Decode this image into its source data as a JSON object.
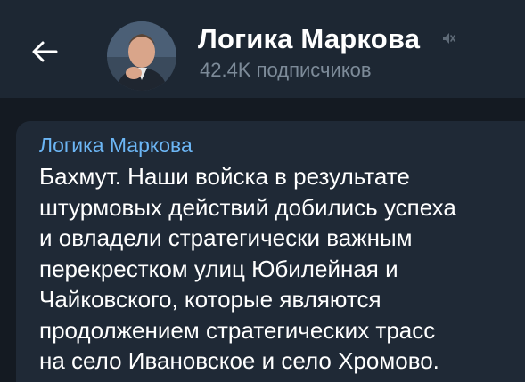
{
  "header": {
    "back_icon": "arrow-left-icon",
    "avatar_icon": "channel-avatar",
    "title": "Логика Маркова",
    "mute_icon": "muted-speaker-icon",
    "subscribers": "42.4K подписчиков"
  },
  "message": {
    "sender": "Логика Маркова",
    "text": "Бахмут. Наши войска в результате\nштурмовых действий добились успеха\nи овладели стратегически важным\nперекрестком улиц Юбилейная и\nЧайковского, которые являются\nпродолжением стратегических трасс\nна село Ивановское и село Хромово."
  },
  "colors": {
    "header_bg": "#1d2733",
    "chat_bg": "#141a22",
    "bubble_bg": "#1f2936",
    "sender_accent": "#6cb6f5",
    "subtitle": "#7d8b99"
  }
}
